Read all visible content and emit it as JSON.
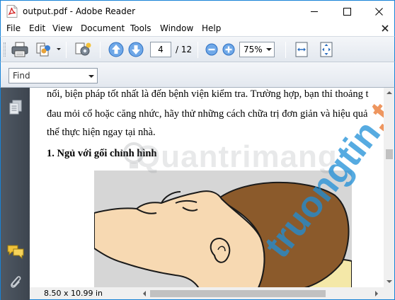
{
  "window": {
    "title": "output.pdf - Adobe Reader"
  },
  "menu": {
    "items": [
      {
        "label": "File",
        "key": "file"
      },
      {
        "label": "Edit",
        "key": "edit"
      },
      {
        "label": "View",
        "key": "view"
      },
      {
        "label": "Document",
        "key": "document"
      },
      {
        "label": "Tools",
        "key": "tools"
      },
      {
        "label": "Window",
        "key": "window"
      },
      {
        "label": "Help",
        "key": "help"
      }
    ]
  },
  "toolbar": {
    "current_page": "4",
    "total_pages": "/ 12",
    "zoom": "75%"
  },
  "find": {
    "placeholder": "Find"
  },
  "document": {
    "lines": [
      "nối, biện pháp tốt nhất là đến bệnh viện kiểm tra. Trường hợp, bạn thỉ thoảng t",
      "đau mỏi cổ hoặc căng nhức, hãy thử những cách chữa trị đơn giản và hiệu quả",
      "thể thực hiện ngay tại nhà."
    ],
    "heading": "1.  Ngủ với gối chỉnh hình"
  },
  "watermark": {
    "brand": "Quantrimang",
    "diag_left": "truongtin",
    "diag_right": ".top"
  },
  "status": {
    "page_size": "8.50 x 10.99 in"
  },
  "colors": {
    "window_border": "#1883d7",
    "nav_panel": "#4a525c",
    "skin": "#f7d9b2",
    "hair": "#8b5a2b",
    "pillow": "#f4e8a8",
    "image_bg": "#d6d6d6"
  }
}
